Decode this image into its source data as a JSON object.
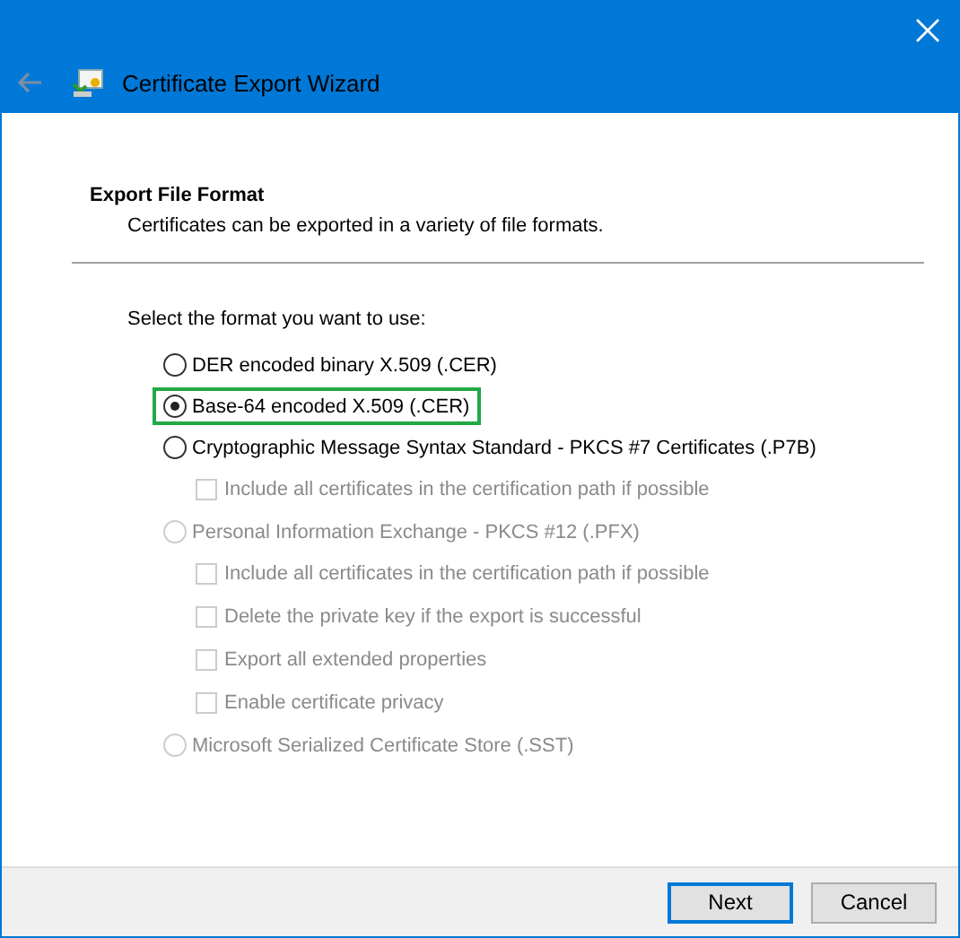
{
  "window": {
    "title": "Certificate Export Wizard"
  },
  "section": {
    "title": "Export File Format",
    "subtitle": "Certificates can be exported in a variety of file formats."
  },
  "prompt": "Select the format you want to use:",
  "options": [
    {
      "label": "DER encoded binary X.509 (.CER)",
      "selected": false,
      "disabled": false,
      "highlighted": false
    },
    {
      "label": "Base-64 encoded X.509 (.CER)",
      "selected": true,
      "disabled": false,
      "highlighted": true
    },
    {
      "label": "Cryptographic Message Syntax Standard - PKCS #7 Certificates (.P7B)",
      "selected": false,
      "disabled": false,
      "highlighted": false,
      "children": [
        {
          "label": "Include all certificates in the certification path if possible",
          "checked": false,
          "disabled": true
        }
      ]
    },
    {
      "label": "Personal Information Exchange - PKCS #12 (.PFX)",
      "selected": false,
      "disabled": true,
      "highlighted": false,
      "children": [
        {
          "label": "Include all certificates in the certification path if possible",
          "checked": false,
          "disabled": true
        },
        {
          "label": "Delete the private key if the export is successful",
          "checked": false,
          "disabled": true
        },
        {
          "label": "Export all extended properties",
          "checked": false,
          "disabled": true
        },
        {
          "label": "Enable certificate privacy",
          "checked": false,
          "disabled": true
        }
      ]
    },
    {
      "label": "Microsoft Serialized Certificate Store (.SST)",
      "selected": false,
      "disabled": true,
      "highlighted": false
    }
  ],
  "buttons": [
    {
      "label": "Next",
      "default": true
    },
    {
      "label": "Cancel",
      "default": false
    }
  ]
}
